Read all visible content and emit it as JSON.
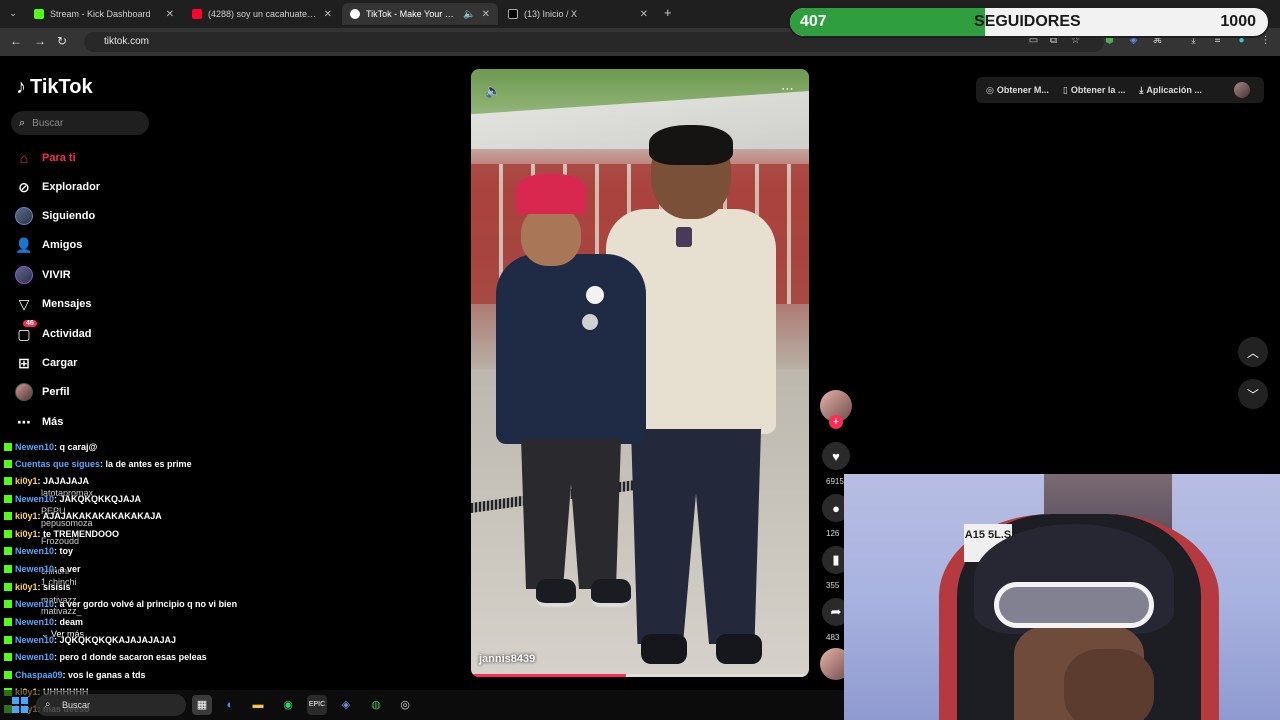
{
  "browser": {
    "tabs": [
      {
        "title": "Stream - Kick Dashboard",
        "color": "#53fc18"
      },
      {
        "title": "(4288) soy un cacahuate - Y",
        "color": "#ff0033"
      },
      {
        "title": "TikTok - Make Your Day",
        "color": "#ffffff"
      },
      {
        "title": "(13) Inicio / X",
        "color": "#ffffff"
      }
    ],
    "url": "tiktok.com"
  },
  "goal": {
    "current": "407",
    "label": "SEGUIDORES",
    "target": "1000",
    "progress": 0.407,
    "fill_color": "#2e9e3e"
  },
  "tiktok": {
    "logo": "TikTok",
    "search_placeholder": "Buscar",
    "nav": [
      {
        "label": "Para ti",
        "icon": "home-icon"
      },
      {
        "label": "Explorador",
        "icon": "compass-icon"
      },
      {
        "label": "Siguiendo",
        "icon": "following-icon"
      },
      {
        "label": "Amigos",
        "icon": "friends-icon"
      },
      {
        "label": "VIVIR",
        "icon": "live-icon"
      },
      {
        "label": "Mensajes",
        "icon": "send-icon"
      },
      {
        "label": "Actividad",
        "icon": "inbox-icon",
        "badge": "46"
      },
      {
        "label": "Cargar",
        "icon": "upload-icon"
      },
      {
        "label": "Perfil",
        "icon": "avatar-icon"
      },
      {
        "label": "Más",
        "icon": "more-icon"
      }
    ],
    "top_actions": [
      "Obtener M...",
      "Obtener la ...",
      "Aplicación ..."
    ],
    "video": {
      "author": "jannis8439",
      "progress": 0.46
    },
    "rail": {
      "likes": "6915",
      "comments": "126",
      "saves": "355",
      "shares": "483"
    },
    "accent": "#fe2c55"
  },
  "chat": [
    {
      "user": "Newen10",
      "text": ": q caraj@",
      "kind": "b"
    },
    {
      "user": "Cuentas que sigues",
      "text": ": la de antes es prime",
      "kind": "b"
    },
    {
      "user": "ki0y1",
      "text": ": JAJAJAJA",
      "kind": "y"
    },
    {
      "user": "Newen10",
      "text": ": JAKQKQKKQJAJA",
      "kind": "b"
    },
    {
      "user": "ki0y1",
      "text": ": AJAJAKAKAKAKAKAKAJA",
      "kind": "y"
    },
    {
      "user": "ki0y1",
      "text": ": te TREMENDOOO",
      "kind": "y"
    },
    {
      "user": "Newen10",
      "text": ": toy",
      "kind": "b"
    },
    {
      "user": "Newen10",
      "text": ": a ver",
      "kind": "b"
    },
    {
      "user": "ki0y1",
      "text": ": sisisis",
      "kind": "y"
    },
    {
      "user": "Newen10",
      "text": ": a ver gordo volvé al principio q no vi bien",
      "kind": "b"
    },
    {
      "user": "Newen10",
      "text": ": deam",
      "kind": "b"
    },
    {
      "user": "Newen10",
      "text": ": JQKQKQKQKAJAJAJAJAJ",
      "kind": "b"
    },
    {
      "user": "Newen10",
      "text": ": pero d donde sacaron esas peleas",
      "kind": "b"
    },
    {
      "user": "Chaspaa09",
      "text": ": vos le ganas a tds",
      "kind": "b"
    },
    {
      "user": "ki0y1",
      "text": ": UHHHHHH",
      "kind": "y"
    },
    {
      "user": "ki0y1",
      "text": ": mas deeso",
      "kind": "y"
    }
  ],
  "ghost_accounts": [
    "latotapromax",
    "PEPU",
    "pepusomoza",
    "Frozoudd",
    "chinchi",
    "1 chinchi",
    "mativazz",
    "mativazz_"
  ],
  "ghost_more": "Ver más",
  "taskbar": {
    "search_placeholder": "Buscar",
    "apps": [
      "files-icon",
      "edge-icon",
      "folder-icon",
      "whatsapp-icon",
      "epic-icon",
      "discord-icon",
      "chrome-icon",
      "obs-icon"
    ]
  },
  "cam": {
    "sticker_text": "A15 5L.S"
  }
}
